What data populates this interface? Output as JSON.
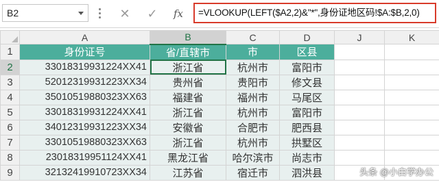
{
  "formula_bar": {
    "name_box": "B2",
    "cancel_icon": "✕",
    "enter_icon": "✓",
    "fx_label": "fx",
    "formula": "=VLOOKUP(LEFT($A2,2)&\"*\",身份证地区码!$A:$B,2,0)"
  },
  "columns": [
    "A",
    "B",
    "C",
    "D",
    "J",
    "K"
  ],
  "rows": [
    "1",
    "2",
    "3",
    "4",
    "5",
    "6",
    "7",
    "8",
    "9"
  ],
  "header": [
    "身份证号",
    "省/直辖市",
    "市",
    "区县"
  ],
  "table": [
    [
      "33018319931224XX41",
      "浙江省",
      "杭州市",
      "富阳市"
    ],
    [
      "52012319931223XX34",
      "贵州省",
      "贵阳市",
      "修文县"
    ],
    [
      "35010519880323XX63",
      "福建省",
      "福州市",
      "马尾区"
    ],
    [
      "33018319931224XX41",
      "浙江省",
      "杭州市",
      "富阳市"
    ],
    [
      "34012319931223XX34",
      "安徽省",
      "合肥市",
      "肥西县"
    ],
    [
      "33010519880323XX63",
      "浙江省",
      "杭州市",
      "拱墅区"
    ],
    [
      "23018319951124XX41",
      "黑龙江省",
      "哈尔滨市",
      "尚志市"
    ],
    [
      "32132419910723XX34",
      "江苏省",
      "宿迁市",
      "泗洪县"
    ]
  ],
  "watermark": "头条 @小白学办公",
  "colors": {
    "header_bg": "#4cae9c",
    "data_bg": "#e8f0ef",
    "formula_border": "#d83a2a",
    "active_cell": "#217346"
  }
}
